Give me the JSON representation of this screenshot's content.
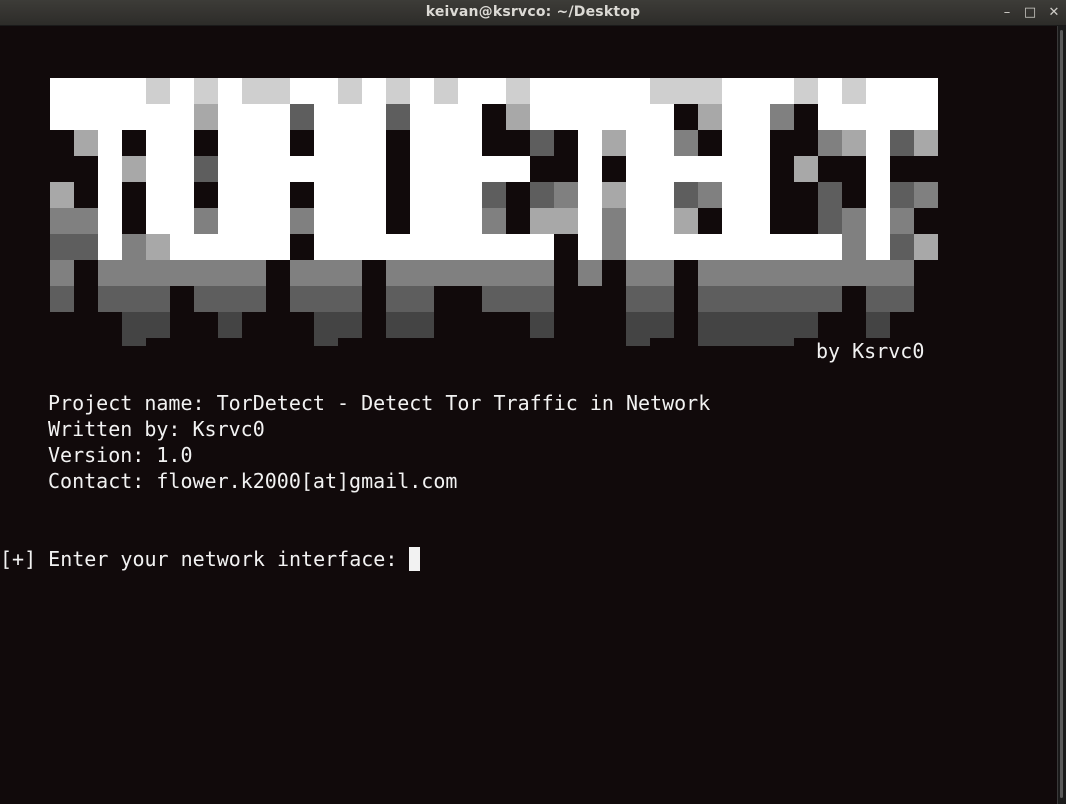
{
  "window": {
    "title": "keivan@ksrvco: ~/Desktop",
    "controls": {
      "minimize": "–",
      "maximize": "□",
      "close": "✕"
    }
  },
  "terminal": {
    "banner_text": "TORDETECT",
    "byline": "by Ksrvc0",
    "info": {
      "project": "Project name: TorDetect - Detect Tor Traffic in Network",
      "author": "Written by: Ksrvc0",
      "version": "Version: 1.0",
      "contact": "Contact: flower.k2000[at]gmail.com"
    },
    "prompt": "[+] Enter your network interface: ",
    "input_value": ""
  },
  "colors": {
    "background": "#110a0b",
    "text": "#f2f2f2",
    "banner_shades": [
      "#ffffff",
      "#cfcfcf",
      "#a8a8a8",
      "#808080",
      "#5e5e5e",
      "#444444"
    ]
  }
}
